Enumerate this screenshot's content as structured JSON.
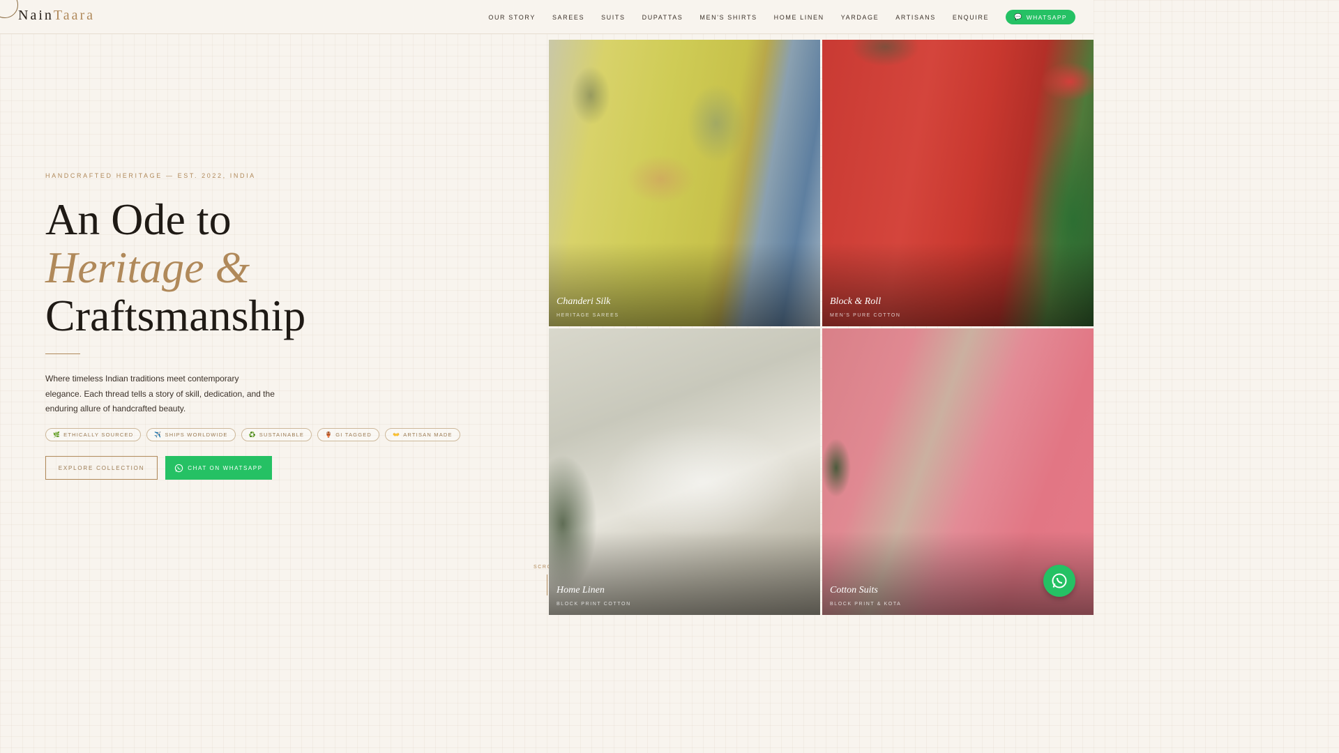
{
  "brand": {
    "name_part1": "Nain",
    "name_part2": "Taara"
  },
  "nav": {
    "items": [
      "OUR STORY",
      "SAREES",
      "SUITS",
      "DUPATTAS",
      "MEN'S SHIRTS",
      "HOME LINEN",
      "YARDAGE",
      "ARTISANS",
      "ENQUIRE"
    ],
    "whatsapp_label": "WHATSAPP"
  },
  "hero": {
    "eyebrow": "HANDCRAFTED HERITAGE — EST. 2022, INDIA",
    "headline_line1": "An Ode to",
    "headline_line2": "Heritage &",
    "headline_line3": "Craftsmanship",
    "description": "Where timeless Indian traditions meet contemporary elegance. Each thread tells a story of skill, dedication, and the enduring allure of handcrafted beauty.",
    "chips": [
      {
        "icon": "🌿",
        "label": "ETHICALLY SOURCED"
      },
      {
        "icon": "✈️",
        "label": "SHIPS WORLDWIDE"
      },
      {
        "icon": "♻️",
        "label": "SUSTAINABLE"
      },
      {
        "icon": "🏺",
        "label": "GI TAGGED"
      },
      {
        "icon": "👐",
        "label": "ARTISAN MADE"
      }
    ],
    "explore_label": "EXPLORE COLLECTION",
    "chat_label": "CHAT ON WHATSAPP",
    "scroll_label": "SCROLL"
  },
  "collections": [
    {
      "title": "Chanderi Silk",
      "subtitle": "HERITAGE SAREES"
    },
    {
      "title": "Block & Roll",
      "subtitle": "MEN'S PURE COTTON"
    },
    {
      "title": "Home Linen",
      "subtitle": "BLOCK PRINT COTTON"
    },
    {
      "title": "Cotton Suits",
      "subtitle": "BLOCK PRINT & KOTA"
    }
  ],
  "colors": {
    "accent": "#b0895a",
    "whatsapp": "#25c164",
    "background": "#f8f4ee"
  }
}
